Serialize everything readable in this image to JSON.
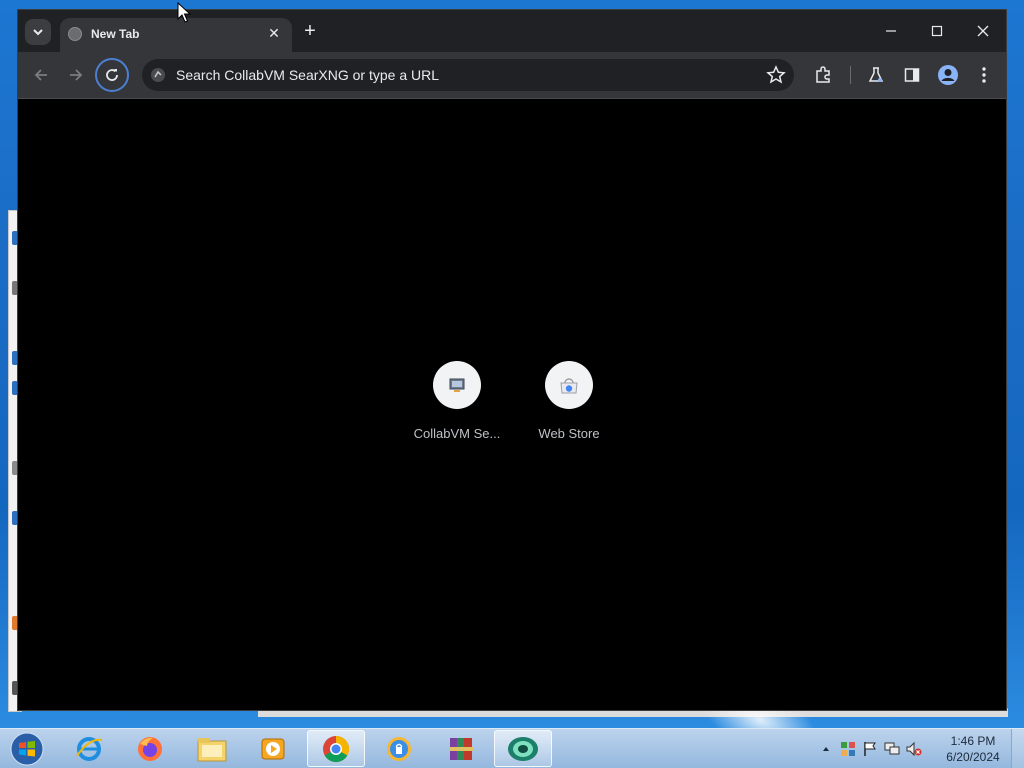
{
  "browser": {
    "tab": {
      "title": "New Tab",
      "close_glyph": "✕",
      "favicon": "globe-icon"
    },
    "new_tab_glyph": "+",
    "window_controls": [
      "minimize",
      "maximize",
      "close"
    ],
    "omnibox": {
      "placeholder": "Search CollabVM SearXNG or type a URL"
    },
    "toolbar_icons": [
      "back-icon",
      "forward-icon",
      "reload-icon",
      "bookmark-star-icon",
      "extensions-icon",
      "labs-flask-icon",
      "side-panel-icon",
      "profile-icon",
      "menu-kebab-icon"
    ],
    "shortcuts": [
      {
        "label": "CollabVM Se...",
        "icon": "collabvm-icon"
      },
      {
        "label": "Web Store",
        "icon": "web-store-icon"
      }
    ],
    "colors": {
      "frame": "#202124",
      "toolbar": "#35363a",
      "content_bg": "#000000",
      "accent_ring": "#4d7fd1",
      "text": "#e8eaed"
    }
  },
  "taskbar": {
    "pinned": [
      "internet-explorer-icon",
      "firefox-icon",
      "file-explorer-icon",
      "media-player-icon",
      "chrome-icon",
      "vpn-shield-icon",
      "winrar-icon",
      "collabvm-app-icon"
    ],
    "active_app": "chrome-icon",
    "tray_icons": [
      "show-hidden-icons-arrow",
      "network-grid-icon",
      "action-center-flag-icon",
      "network-monitor-icon",
      "volume-muted-icon"
    ],
    "clock": {
      "time": "1:46 PM",
      "date": "6/20/2024"
    }
  }
}
